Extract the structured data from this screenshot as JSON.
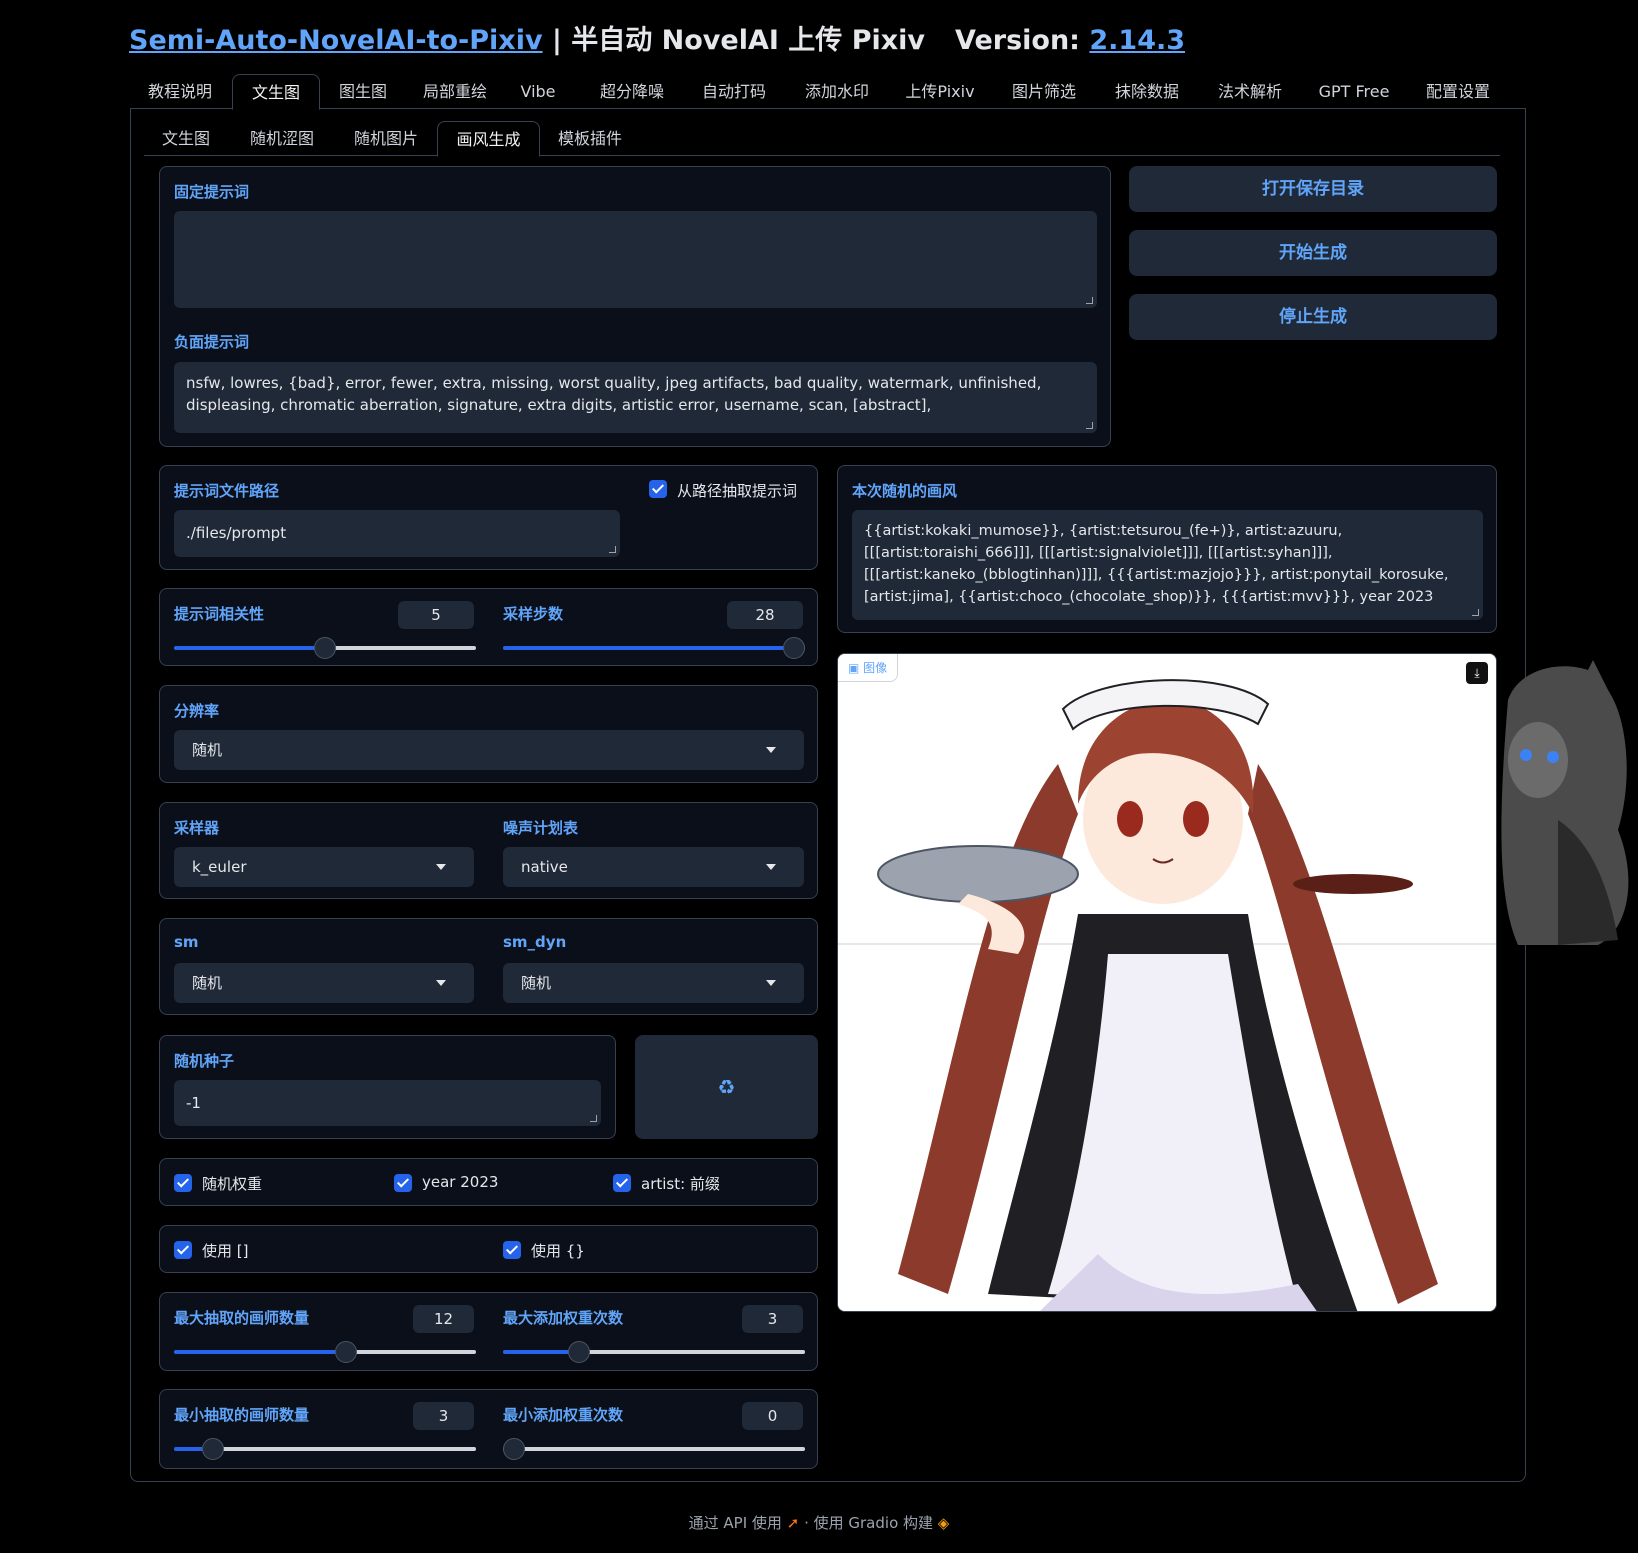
{
  "header": {
    "project_link": "Semi-Auto-NovelAI-to-Pixiv",
    "separator": " | ",
    "subtitle": "半自动 NovelAI 上传 Pixiv",
    "version_label": "Version: ",
    "version_link": "2.14.3"
  },
  "top_tabs": [
    "教程说明",
    "文生图",
    "图生图",
    "局部重绘",
    "Vibe",
    "超分降噪",
    "自动打码",
    "添加水印",
    "上传Pixiv",
    "图片筛选",
    "抹除数据",
    "法术解析",
    "GPT Free",
    "配置设置"
  ],
  "active_top_tab": "文生图",
  "sub_tabs": [
    "文生图",
    "随机涩图",
    "随机图片",
    "画风生成",
    "模板插件"
  ],
  "active_sub_tab": "画风生成",
  "prompt": {
    "fixed_label": "固定提示词",
    "fixed_value": "",
    "negative_label": "负面提示词",
    "negative_value": "nsfw, lowres, {bad}, error, fewer, extra, missing, worst quality, jpeg artifacts, bad quality, watermark, unfinished, displeasing, chromatic aberration, signature, extra digits, artistic error, username, scan, [abstract],"
  },
  "actions": {
    "open_folder": "打开保存目录",
    "start": "开始生成",
    "stop": "停止生成"
  },
  "prompt_file": {
    "label": "提示词文件路径",
    "value": "./files/prompt",
    "extract_checkbox": "从路径抽取提示词",
    "extract_checked": true
  },
  "style_output": {
    "label": "本次随机的画风",
    "value": "{{artist:kokaki_mumose}}, {artist:tetsurou_(fe+)}, artist:azuuru, [[[artist:toraishi_666]]], [[[artist:signalviolet]]], [[[artist:syhan]]], [[[artist:kaneko_(bblogtinhan)]]], {{{artist:mazjojo}}}, artist:ponytail_korosuke, [artist:jima], {{artist:choco_(chocolate_shop)}}, {{{artist:mvv}}}, year 2023"
  },
  "scale": {
    "label": "提示词相关性",
    "value": "5",
    "fraction": 0.5
  },
  "steps": {
    "label": "采样步数",
    "value": "28",
    "fraction": 0.97
  },
  "resolution": {
    "label": "分辨率",
    "value": "随机"
  },
  "sampler": {
    "label": "采样器",
    "value": "k_euler"
  },
  "noise_schedule": {
    "label": "噪声计划表",
    "value": "native"
  },
  "sm": {
    "label": "sm",
    "value": "随机"
  },
  "sm_dyn": {
    "label": "sm_dyn",
    "value": "随机"
  },
  "seed": {
    "label": "随机种子",
    "value": "-1",
    "button_icon": "recycle-icon",
    "button_glyph": "♻"
  },
  "options_row1": [
    {
      "label": "随机权重",
      "checked": true
    },
    {
      "label": "year 2023",
      "checked": true
    },
    {
      "label": "artist: 前缀",
      "checked": true
    }
  ],
  "options_row2": [
    {
      "label": "使用 []",
      "checked": true
    },
    {
      "label": "使用 {}",
      "checked": true
    }
  ],
  "max_artists": {
    "label": "最大抽取的画师数量",
    "value": "12",
    "fraction": 0.57
  },
  "max_weight": {
    "label": "最大添加权重次数",
    "value": "3",
    "fraction": 0.25
  },
  "min_artists": {
    "label": "最小抽取的画师数量",
    "value": "3",
    "fraction": 0.13
  },
  "min_weight": {
    "label": "最小添加权重次数",
    "value": "0",
    "fraction": 0.0
  },
  "image": {
    "badge": "图像",
    "badge_icon": "image-icon",
    "download_icon": "download-icon"
  },
  "footer": {
    "api": "通过 API 使用",
    "dot": " · ",
    "built": "使用 Gradio 构建"
  },
  "colors": {
    "accent": "#60a5fa",
    "check": "#2563eb",
    "background": "#000000",
    "panel": "#0b0f19",
    "input": "#1f2937"
  }
}
